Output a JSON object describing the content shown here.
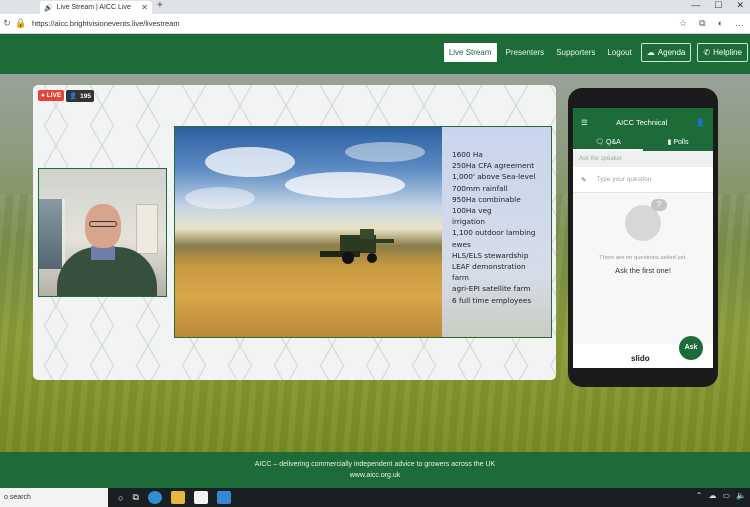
{
  "browser": {
    "tab_title": "Live Stream | AICC Live",
    "url": "https://aicc.brightvisionevents.live/livestream"
  },
  "nav": {
    "items": [
      "Live Stream",
      "Presenters",
      "Supporters",
      "Logout"
    ],
    "active": "Live Stream",
    "agenda": "Agenda",
    "helpline": "Helpline"
  },
  "stream": {
    "live_label": "LIVE",
    "viewers": "195"
  },
  "slide": {
    "lines": [
      "1600 Ha",
      "250Ha CFA agreement",
      "1,000' above Sea-level",
      "700mm rainfall",
      "950Ha combinable",
      "100Ha veg",
      "irrigation",
      "1,100 outdoor lambing",
      "ewes",
      "HLS/ELS stewardship",
      "LEAF demonstration",
      "farm",
      "agri-EPI satellite farm",
      "6 full time employees"
    ]
  },
  "slido": {
    "title": "AICC Technical",
    "tab_qa": "Q&A",
    "tab_polls": "Polls",
    "ask_speaker": "Ask the speaker",
    "placeholder": "Type your question",
    "empty_line1": "There are no questions asked yet.",
    "empty_line2": "Ask the first one!",
    "brand": "slido",
    "ask_button": "Ask"
  },
  "footer": {
    "line1": "AICC – delivering commercially independent advice to growers across the UK",
    "line2": "www.aicc.org.uk"
  },
  "taskbar": {
    "search": "o search"
  },
  "colors": {
    "brand_green": "#1d6b38",
    "live_red": "#e4453a"
  }
}
